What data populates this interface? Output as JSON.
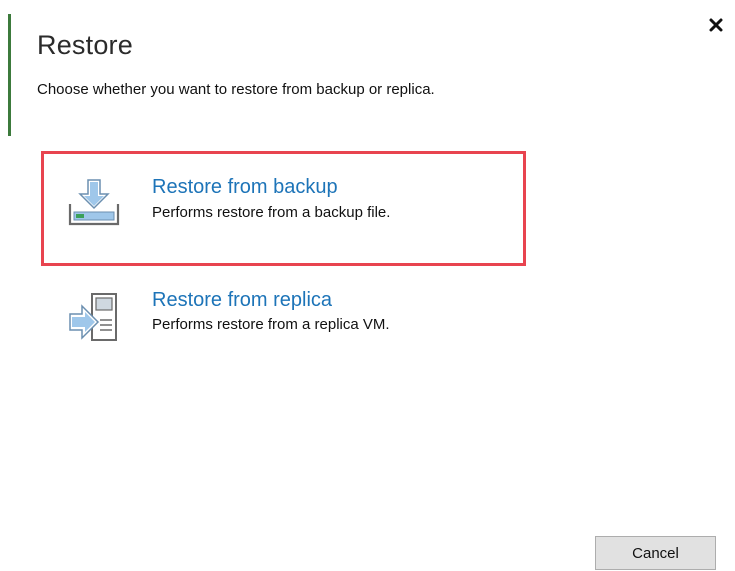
{
  "dialog": {
    "title": "Restore",
    "subtitle": "Choose whether you want to restore from backup or replica.",
    "close_icon": "close-icon"
  },
  "options": [
    {
      "title": "Restore from backup",
      "description": "Performs restore from a backup file.",
      "icon": "backup-restore-icon",
      "selected": true
    },
    {
      "title": "Restore from replica",
      "description": "Performs restore from a replica VM.",
      "icon": "replica-restore-icon",
      "selected": false
    }
  ],
  "footer": {
    "cancel_label": "Cancel"
  },
  "colors": {
    "accent_bar": "#3c7a3c",
    "link_title": "#1d74b8",
    "selection_border": "#e8444f",
    "icon_blue": "#9fc7ea"
  }
}
